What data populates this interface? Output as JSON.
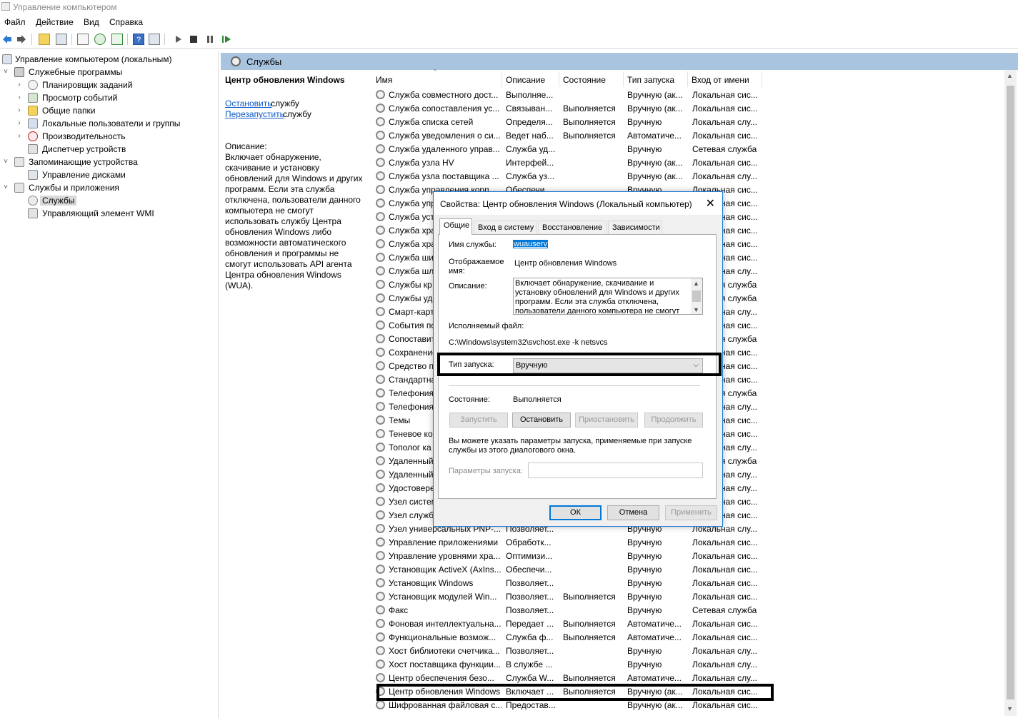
{
  "window": {
    "title": "Управление компьютером"
  },
  "menu": [
    "Файл",
    "Действие",
    "Вид",
    "Справка"
  ],
  "tree": {
    "root": "Управление компьютером (локальным)",
    "utilities": "Служебные программы",
    "scheduler": "Планировщик заданий",
    "eventviewer": "Просмотр событий",
    "sharedfolders": "Общие папки",
    "localusers": "Локальные пользователи и группы",
    "performance": "Производительность",
    "devmgr": "Диспетчер устройств",
    "storage": "Запоминающие устройства",
    "diskmgmt": "Управление дисками",
    "services_apps": "Службы и приложения",
    "services": "Службы",
    "wmi": "Управляющий элемент WMI"
  },
  "pane": {
    "header": "Службы"
  },
  "ext": {
    "title": "Центр обновления Windows",
    "stop_link": "Остановить",
    "stop_tail": " службу",
    "restart_link": "Перезапустить",
    "restart_tail": " службу",
    "desc_label": "Описание:",
    "desc": "Включает обнаружение, скачивание и установку обновлений для Windows и других программ. Если эта служба отключена, пользователи данного компьютера не смогут использовать службу Центра обновления Windows либо возможности автоматического обновления и программы не смогут использовать API агента Центра обновления Windows (WUA)."
  },
  "columns": [
    "Имя",
    "Описание",
    "Состояние",
    "Тип запуска",
    "Вход от имени"
  ],
  "rows": [
    [
      "Служба совместного дост...",
      "Выполняе...",
      "",
      "Вручную (ак...",
      "Локальная сис..."
    ],
    [
      "Служба сопоставления ус...",
      "Связыван...",
      "Выполняется",
      "Вручную (ак...",
      "Локальная сис..."
    ],
    [
      "Служба списка сетей",
      "Определя...",
      "Выполняется",
      "Вручную",
      "Локальная слу..."
    ],
    [
      "Служба уведомления о си...",
      "Ведет наб...",
      "Выполняется",
      "Автоматиче...",
      "Локальная сис..."
    ],
    [
      "Служба удаленного управ...",
      "Служба уд...",
      "",
      "Вручную",
      "Сетевая служба"
    ],
    [
      "Служба узла HV",
      "Интерфей...",
      "",
      "Вручную (ак...",
      "Локальная сис..."
    ],
    [
      "Служба узла поставщика ...",
      "Служба уз...",
      "",
      "Вручную (ак...",
      "Локальная слу..."
    ],
    [
      "Служба управления корп...",
      "Обеспечи...",
      "",
      "Вручную",
      "Локальная сис..."
    ],
    [
      "Служба упр",
      "",
      "",
      "",
      "Локальная сис..."
    ],
    [
      "Служба уст",
      "",
      "",
      "",
      "Локальная сис..."
    ],
    [
      "Служба хра",
      "",
      "",
      "",
      "Локальная сис..."
    ],
    [
      "Служба хра",
      "",
      "",
      "",
      "Локальная сис..."
    ],
    [
      "Служба ши",
      "",
      "",
      "",
      "Локальная сис..."
    ],
    [
      "Служба шл",
      "",
      "",
      "",
      "Локальная слу..."
    ],
    [
      "Службы кр",
      "",
      "",
      "",
      "Сетевая служба"
    ],
    [
      "Службы уд",
      "",
      "",
      "",
      "Сетевая служба"
    ],
    [
      "Смарт-карт",
      "",
      "",
      "",
      "Локальная слу..."
    ],
    [
      "События по",
      "",
      "",
      "",
      "Локальная сис..."
    ],
    [
      "Сопоставит",
      "",
      "",
      "",
      "Сетевая служба"
    ],
    [
      "Сохранение",
      "",
      "",
      "",
      "Локальная сис..."
    ],
    [
      "Средство п",
      "",
      "",
      "",
      "Локальная сис..."
    ],
    [
      "Стандартна",
      "",
      "",
      "",
      "Локальная сис..."
    ],
    [
      "Телефония",
      "",
      "",
      "",
      "Сетевая служба"
    ],
    [
      "Телефония",
      "",
      "",
      "",
      "Локальная слу..."
    ],
    [
      "Темы",
      "",
      "",
      "",
      "Локальная сис..."
    ],
    [
      "Теневое ко",
      "",
      "",
      "",
      "Локальная сис..."
    ],
    [
      "Тополог ка",
      "",
      "",
      "",
      "Локальная слу..."
    ],
    [
      "Удаленный",
      "",
      "",
      "",
      "Сетевая служба"
    ],
    [
      "Удаленный",
      "",
      "",
      "",
      "Локальная слу..."
    ],
    [
      "Удостовере",
      "",
      "",
      "",
      "Локальная слу..."
    ],
    [
      "Узел систем",
      "",
      "",
      "",
      "Локальная сис..."
    ],
    [
      "Узел служб",
      "",
      "",
      "",
      "Локальная сис..."
    ],
    [
      "Узел универсальных PNP-...",
      "Позволяет...",
      "",
      "Вручную",
      "Локальная слу..."
    ],
    [
      "Управление приложениями",
      "Обработк...",
      "",
      "Вручную",
      "Локальная сис..."
    ],
    [
      "Управление уровнями хра...",
      "Оптимизи...",
      "",
      "Вручную",
      "Локальная сис..."
    ],
    [
      "Установщик ActiveX (AxIns...",
      "Обеспечи...",
      "",
      "Вручную",
      "Локальная сис..."
    ],
    [
      "Установщик Windows",
      "Позволяет...",
      "",
      "Вручную",
      "Локальная сис..."
    ],
    [
      "Установщик модулей Win...",
      "Позволяет...",
      "Выполняется",
      "Вручную",
      "Локальная сис..."
    ],
    [
      "Факс",
      "Позволяет...",
      "",
      "Вручную",
      "Сетевая служба"
    ],
    [
      "Фоновая интеллектуальна...",
      "Передает ...",
      "Выполняется",
      "Автоматиче...",
      "Локальная сис..."
    ],
    [
      "Функциональные возмож...",
      "Служба ф...",
      "Выполняется",
      "Автоматиче...",
      "Локальная сис..."
    ],
    [
      "Хост библиотеки счетчика...",
      "Позволяет...",
      "",
      "Вручную",
      "Локальная слу..."
    ],
    [
      "Хост поставщика функции...",
      "В службе ...",
      "",
      "Вручную",
      "Локальная слу..."
    ],
    [
      "Центр обеспечения безо...",
      "Служба W...",
      "Выполняется",
      "Автоматиче...",
      "Локальная слу..."
    ],
    [
      "Центр обновления Windows",
      "Включает ...",
      "Выполняется",
      "Вручную (ак...",
      "Локальная сис..."
    ],
    [
      "Шифрованная файловая с...",
      "Предостав...",
      "",
      "Вручную (ак...",
      "Локальная сис..."
    ]
  ],
  "dialog": {
    "title": "Свойства: Центр обновления Windows (Локальный компьютер)",
    "tabs": [
      "Общие",
      "Вход в систему",
      "Восстановление",
      "Зависимости"
    ],
    "service_name_label": "Имя службы:",
    "service_name": "wuauserv",
    "display_name_label1": "Отображаемое",
    "display_name_label2": "имя:",
    "display_name": "Центр обновления Windows",
    "description_label": "Описание:",
    "description": "Включает обнаружение, скачивание и установку обновлений для Windows и других программ. Если эта служба отключена, пользователи данного компьютера не смогут использовать",
    "exe_label": "Исполняемый файл:",
    "exe_path": "C:\\Windows\\system32\\svchost.exe -k netsvcs",
    "startup_label": "Тип запуска:",
    "startup_value": "Вручную",
    "status_label": "Состояние:",
    "status_value": "Выполняется",
    "btn_start": "Запустить",
    "btn_stop": "Остановить",
    "btn_pause": "Приостановить",
    "btn_resume": "Продолжить",
    "hint": "Вы можете указать параметры запуска, применяемые при запуске службы из этого диалогового окна.",
    "params_label": "Параметры запуска:",
    "ok": "ОК",
    "cancel": "Отмена",
    "apply": "Применить"
  }
}
